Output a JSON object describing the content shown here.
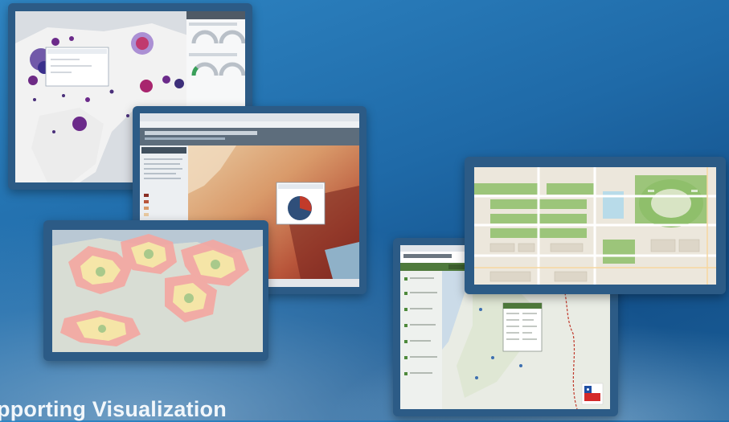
{
  "page": {
    "caption": "pporting Visualization"
  },
  "colors": {
    "background": "#1f6aa8",
    "frame": "#2c5b86",
    "bubble": "#6b2a8a",
    "halo_outer": "#f4a6a0",
    "halo_inner": "#f6e9a8",
    "park_green": "#8fbf6b",
    "flag_blue": "#1f4fa3",
    "flag_red": "#d42a2a"
  },
  "screens": {
    "world_bubble_map": {
      "icon": "bubble-map"
    },
    "elevation_map": {
      "icon": "pie-chart"
    },
    "us_drive_time_map": {
      "icon": "halo-map"
    },
    "city_street_map": {
      "icon": "street-map"
    },
    "regional_app": {
      "icon": "flag-logo"
    }
  }
}
